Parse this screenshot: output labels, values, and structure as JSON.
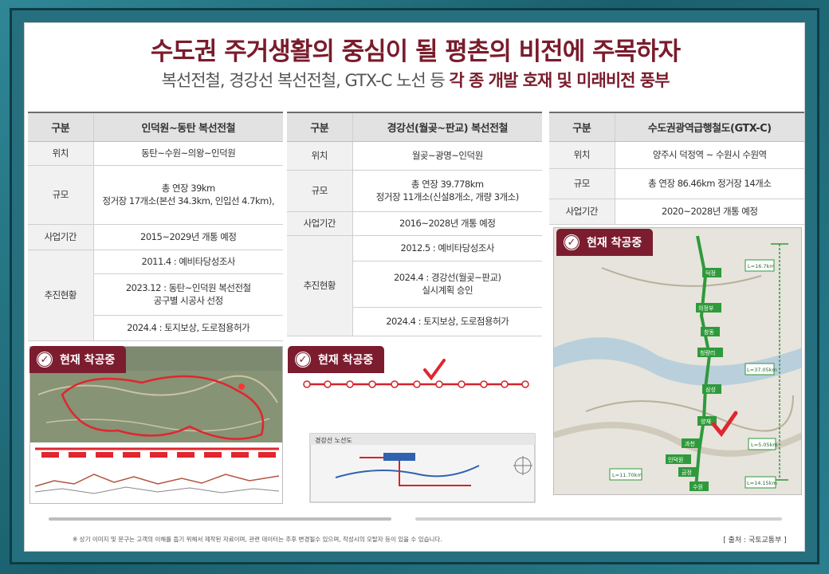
{
  "title": "수도권 주거생활의 중심이 될 평촌의 비전에 주목하자",
  "subtitle": {
    "plain": "복선전철, 경강선 복선전철, GTX-C 노선 등 ",
    "highlight": "각 종 개발 호재 및 미래비전 풍부"
  },
  "tables": [
    {
      "header": [
        "구분",
        "인덕원~동탄 복선전철"
      ],
      "rows": {
        "location_key": "위치",
        "location_val": "동탄~수원~의왕~인덕원",
        "scale_key": "규모",
        "scale_val1": "총 연장 39km",
        "scale_val2": "정거장 17개소(본선 34.3km, 인입선 4.7km),",
        "period_key": "사업기간",
        "period_val": "2015~2029년 개통 예정",
        "status_key": "추진현황",
        "status1": "2011.4 : 예비타당성조사",
        "status2a": "2023.12 : 동탄~인덕원 복선전철",
        "status2b": "공구별 시공사 선정",
        "status3": "2024.4 : 토지보상, 도로점용허가"
      }
    },
    {
      "header": [
        "구분",
        "경강선(월곶~판교) 복선전철"
      ],
      "rows": {
        "location_key": "위치",
        "location_val": "월곶~광명~인덕원",
        "scale_key": "규모",
        "scale_val1": "총 연장 39.778km",
        "scale_val2": "정거장 11개소(신설8개소, 개량 3개소)",
        "period_key": "사업기간",
        "period_val": "2016~2028년 개통 예정",
        "status_key": "추진현황",
        "status1": "2012.5 : 예비타당성조사",
        "status2a": "2024.4 : 경강선(월곶~판교)",
        "status2b": "실시계획 승인",
        "status3": "2024.4 : 토지보상, 도로점용허가"
      }
    },
    {
      "header": [
        "구분",
        "수도권광역급행철도(GTX-C)"
      ],
      "rows": {
        "location_key": "위치",
        "location_val": "양주시 덕정역 ~ 수원시 수원역",
        "scale_key": "규모",
        "scale_val1": "총 연장 86.46km 정거장 14개소",
        "period_key": "사업기간",
        "period_val": "2020~2028년 개통 예정"
      }
    }
  ],
  "badges": {
    "label": "현재 착공중",
    "check_icon": "✓"
  },
  "map_labels": {
    "gyeonggang_title": "경강선 노선도",
    "gtx_seg1": "L=16.7km",
    "gtx_seg2": "L=37.05km",
    "gtx_seg3": "L=5.05km",
    "gtx_seg4": "L=14.15km",
    "gtx_seg5": "L=11.70km",
    "gtx_station_a": "덕정",
    "gtx_station_b": "의정부",
    "gtx_station_c": "창동",
    "gtx_station_d": "청량리",
    "gtx_station_e": "삼성",
    "gtx_station_f": "양재",
    "gtx_station_g": "과천",
    "gtx_station_h": "인덕원",
    "gtx_station_i": "금정",
    "gtx_station_j": "수원"
  },
  "footnote": "※ 상기 이미지 및 문구는 고객의 이해를 돕기 위해서 제작된 자료이며, 관련 데이터는 추후 변경될수 있으며, 작성시의 오탈자 등이 있을 수 있습니다.",
  "source": "[ 출처 : 국토교통부 ]",
  "colors": {
    "brand": "#7a1c2c",
    "badge": "#7b1d2f",
    "route_red": "#d3242b",
    "route_green": "#2f9a3b"
  }
}
